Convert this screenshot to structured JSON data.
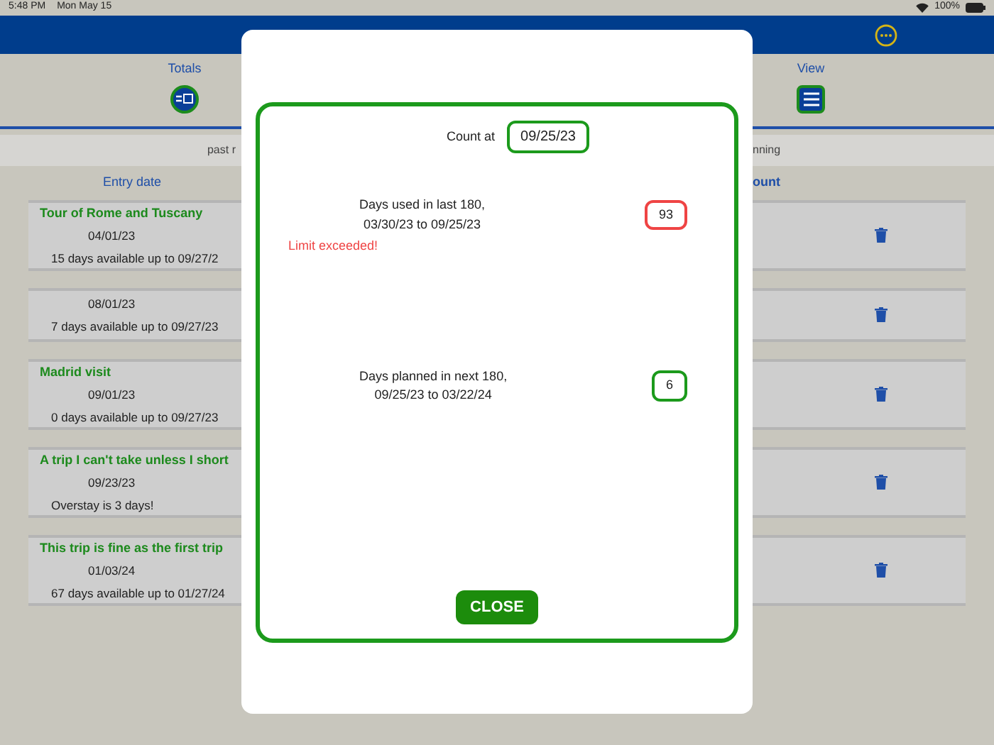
{
  "status_bar": {
    "time": "5:48 PM",
    "date": "Mon May 15",
    "battery": "100%"
  },
  "toolbar": [
    {
      "label": "Totals",
      "kind": "circle"
    },
    {
      "label": "View",
      "kind": "square"
    }
  ],
  "subheader": {
    "left": "past r",
    "right": "nning"
  },
  "list": {
    "columns": [
      "Entry date",
      "ount"
    ],
    "rows": [
      {
        "title": "Tour of Rome and Tuscany",
        "date": "04/01/23",
        "note": "15 days available up to  09/27/2"
      },
      {
        "date": "08/01/23",
        "note": "7 days available up to  09/27/23"
      },
      {
        "title": "Madrid visit",
        "date": "09/01/23",
        "note": "0 days available up to  09/27/23"
      },
      {
        "title": "A trip I can't take unless I short",
        "date": "09/23/23",
        "note": "Overstay is 3 days!"
      },
      {
        "title": "This trip is fine as the first trip",
        "date": "01/03/24",
        "note": "67 days available up to  01/27/24"
      }
    ]
  },
  "dialog": {
    "count_label": "Count at",
    "count_value": "09/25/23",
    "stats": [
      {
        "text": "Days used in last 180,\n03/30/23 to  09/25/23",
        "value": "93",
        "exceeded": true,
        "warning": "Limit exceeded!"
      },
      {
        "text": "Days planned in next 180,\n09/25/23 to  03/22/24",
        "value": "6",
        "exceeded": false
      }
    ],
    "close": "CLOSE"
  }
}
